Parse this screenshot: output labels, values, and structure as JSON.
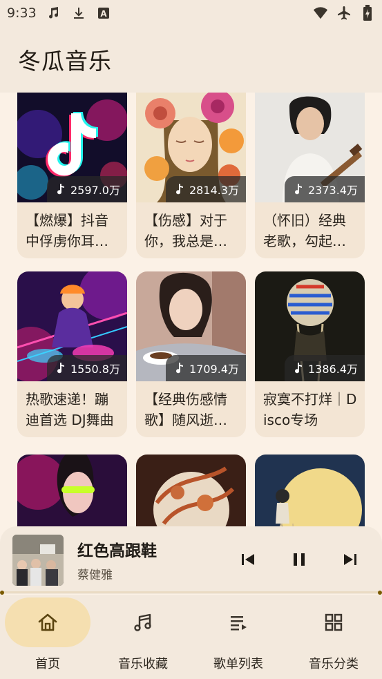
{
  "status_bar": {
    "time": "9:33",
    "icons_left": [
      "music-note-icon",
      "download-icon",
      "font-a-icon"
    ],
    "icons_right": [
      "wifi-icon",
      "airplane-icon",
      "battery-icon"
    ]
  },
  "app": {
    "title": "冬瓜音乐"
  },
  "playlists": [
    {
      "plays": "2597.0万",
      "title": "【燃爆】抖音中俘虏你耳朵的DJ热歌",
      "cover": "tiktok-neon"
    },
    {
      "plays": "2814.3万",
      "title": "【伤感】对于你，我总是无能为力",
      "cover": "flower-girl"
    },
    {
      "plays": "2373.4万",
      "title": "（怀旧）经典老歌，勾起你的回忆",
      "cover": "woman-guitar"
    },
    {
      "plays": "1550.8万",
      "title": "热歌速递！蹦迪首选 DJ舞曲",
      "cover": "dj-neon"
    },
    {
      "plays": "1709.4万",
      "title": "【经典伤感情歌】随风逝去的爱",
      "cover": "woman-coffee"
    },
    {
      "plays": "1386.4万",
      "title": "寂寞不打烊｜Disco专场",
      "cover": "disco-head"
    },
    {
      "plays": "",
      "title": "",
      "cover": "neon-glasses"
    },
    {
      "plays": "",
      "title": "",
      "cover": "moon-leaves"
    },
    {
      "plays": "",
      "title": "",
      "cover": "moon-girl"
    }
  ],
  "now_playing": {
    "title": "红色高跟鞋",
    "artist": "蔡健雅",
    "progress": 0.0
  },
  "nav": [
    {
      "label": "首页",
      "icon": "home-icon",
      "active": true
    },
    {
      "label": "音乐收藏",
      "icon": "music-note-icon",
      "active": false
    },
    {
      "label": "歌单列表",
      "icon": "playlist-icon",
      "active": false
    },
    {
      "label": "音乐分类",
      "icon": "grid-icon",
      "active": false
    }
  ],
  "colors": {
    "background": "#fbf1e6",
    "surface": "#f3e9dd",
    "card": "#f3e5d4",
    "active_pill": "#f5dfb0",
    "accent": "#7a5a00"
  }
}
